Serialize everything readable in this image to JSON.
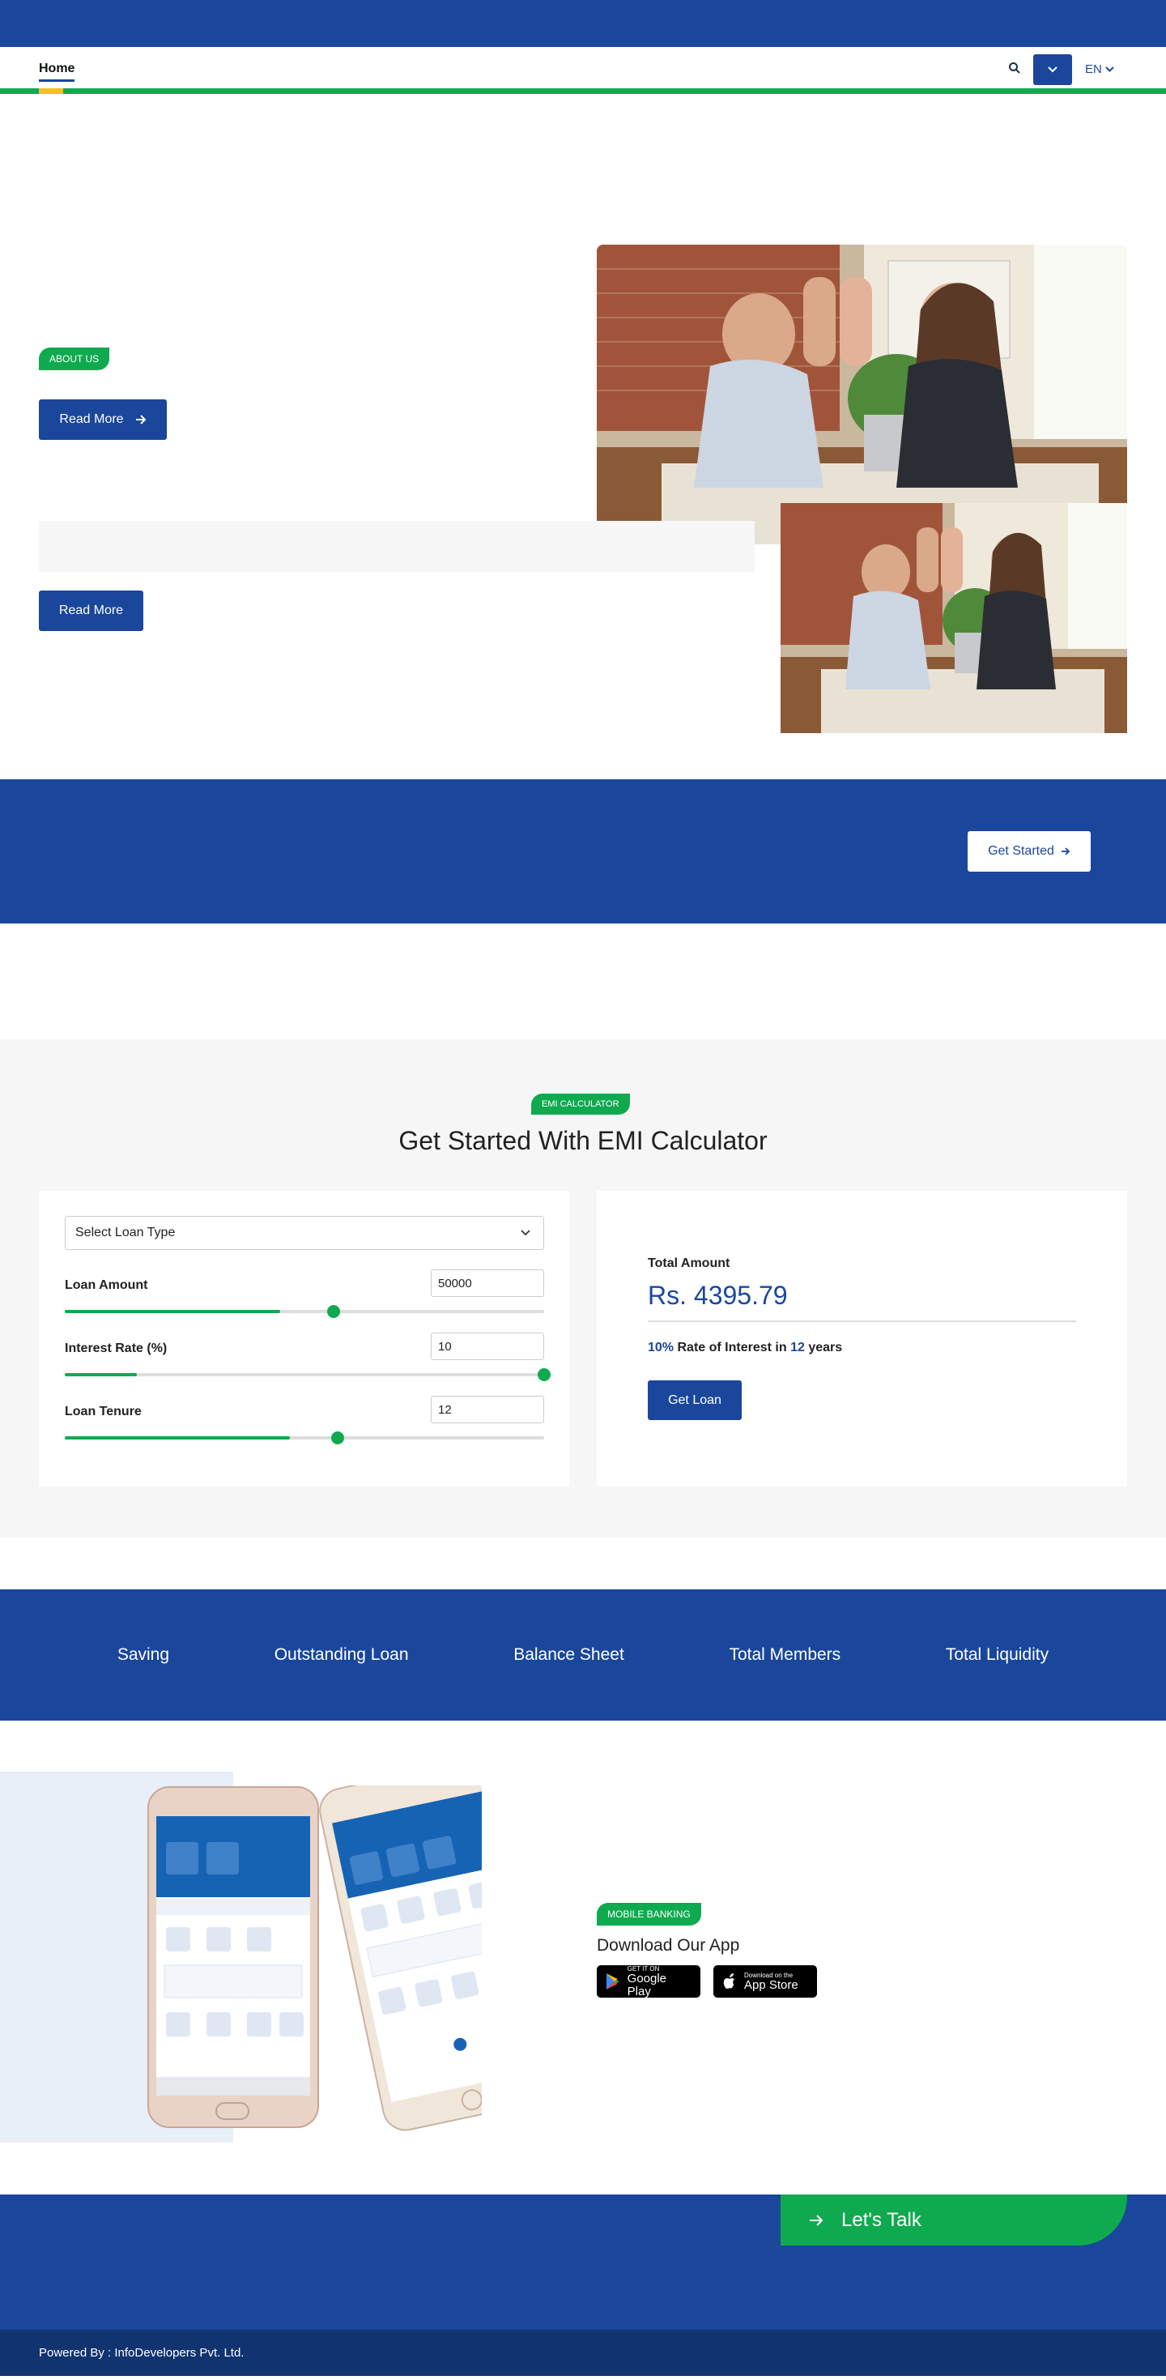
{
  "nav": {
    "home_label": "Home",
    "language": "EN",
    "icons": [
      "search-icon",
      "chevron-down-icon"
    ],
    "colors": {
      "primary": "#1a479c",
      "accent_green": "#0faa4f",
      "accent_yellow": "#f6c21a"
    }
  },
  "about": {
    "tag": "ABOUT US",
    "read_more": "Read More"
  },
  "section2": {
    "read_more": "Read More"
  },
  "cta": {
    "get_started": "Get Started"
  },
  "emi": {
    "tag": "EMI CALCULATOR",
    "title": "Get Started With EMI Calculator",
    "loan_type_placeholder": "Select Loan Type",
    "sliders": [
      {
        "label": "Loan Amount",
        "value": "50000",
        "fill": 0.45,
        "thumb": 0.56
      },
      {
        "label": "Interest Rate (%)",
        "value": "10",
        "fill": 0.15,
        "thumb": 1.0
      },
      {
        "label": "Loan Tenure",
        "value": "12",
        "fill": 0.47,
        "thumb": 0.57
      }
    ],
    "total_label": "Total Amount",
    "total_value": "Rs. 4395.79",
    "rate_pct": "10%",
    "rate_text": "Rate of Interest in",
    "years_value": "12",
    "years_text": "years",
    "get_loan": "Get Loan"
  },
  "stats": [
    "Saving",
    "Outstanding Loan",
    "Balance Sheet",
    "Total Members",
    "Total Liquidity"
  ],
  "app": {
    "tag": "MOBILE BANKING",
    "title": "Download Our App",
    "google_small": "GET IT ON",
    "google_big": "Google Play",
    "apple_small": "Download on the",
    "apple_big": "App Store"
  },
  "footer": {
    "lets_talk": "Let's Talk",
    "powered_by": "Powered By : InfoDevelopers Pvt. Ltd."
  }
}
